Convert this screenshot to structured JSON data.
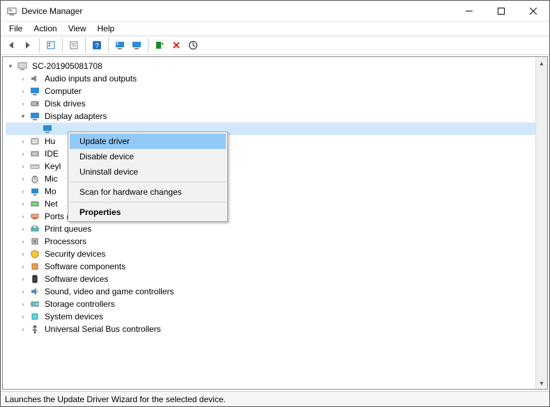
{
  "window": {
    "title": "Device Manager"
  },
  "menus": [
    "File",
    "Action",
    "View",
    "Help"
  ],
  "toolbar_icons": [
    "back-icon",
    "forward-icon",
    "sep",
    "show-hidden-icon",
    "sep",
    "properties-icon",
    "sep",
    "help-icon",
    "sep",
    "monitor-list-icon",
    "monitor-icon",
    "sep",
    "scan-icon",
    "remove-icon",
    "enable-icon"
  ],
  "tree": {
    "root": {
      "label": "SC-201905081708",
      "icon": "computer-small-icon",
      "expanded": true
    },
    "children": [
      {
        "label": "Audio inputs and outputs",
        "icon": "speaker-icon"
      },
      {
        "label": "Computer",
        "icon": "monitor-blue-icon"
      },
      {
        "label": "Disk drives",
        "icon": "disk-icon"
      },
      {
        "label": "Display adapters",
        "icon": "monitor-blue-icon",
        "expanded": true,
        "children": [
          {
            "label": "",
            "icon": "monitor-blue-icon",
            "selected": true
          }
        ]
      },
      {
        "label": "Hu",
        "icon": "hid-icon",
        "clipped": true
      },
      {
        "label": "IDE",
        "icon": "ide-icon",
        "clipped": true
      },
      {
        "label": "Keyl",
        "icon": "keyboard-icon",
        "clipped": true
      },
      {
        "label": "Mic",
        "icon": "mouse-icon",
        "clipped": true
      },
      {
        "label": "Mo",
        "icon": "monitor-small-icon",
        "clipped": true
      },
      {
        "label": "Net",
        "icon": "network-icon",
        "clipped": true
      },
      {
        "label": "Ports (COM & LPT)",
        "icon": "port-icon"
      },
      {
        "label": "Print queues",
        "icon": "printer-icon"
      },
      {
        "label": "Processors",
        "icon": "cpu-icon"
      },
      {
        "label": "Security devices",
        "icon": "shield-icon"
      },
      {
        "label": "Software components",
        "icon": "component-icon"
      },
      {
        "label": "Software devices",
        "icon": "device-icon"
      },
      {
        "label": "Sound, video and game controllers",
        "icon": "sound-icon"
      },
      {
        "label": "Storage controllers",
        "icon": "storage-icon"
      },
      {
        "label": "System devices",
        "icon": "chip-icon"
      },
      {
        "label": "Universal Serial Bus controllers",
        "icon": "usb-icon"
      }
    ]
  },
  "context_menu": {
    "items": [
      {
        "label": "Update driver",
        "highlight": true
      },
      {
        "label": "Disable device"
      },
      {
        "label": "Uninstall device"
      },
      {
        "sep": true
      },
      {
        "label": "Scan for hardware changes"
      },
      {
        "sep": true
      },
      {
        "label": "Properties",
        "bold": true
      }
    ]
  },
  "status": "Launches the Update Driver Wizard for the selected device."
}
